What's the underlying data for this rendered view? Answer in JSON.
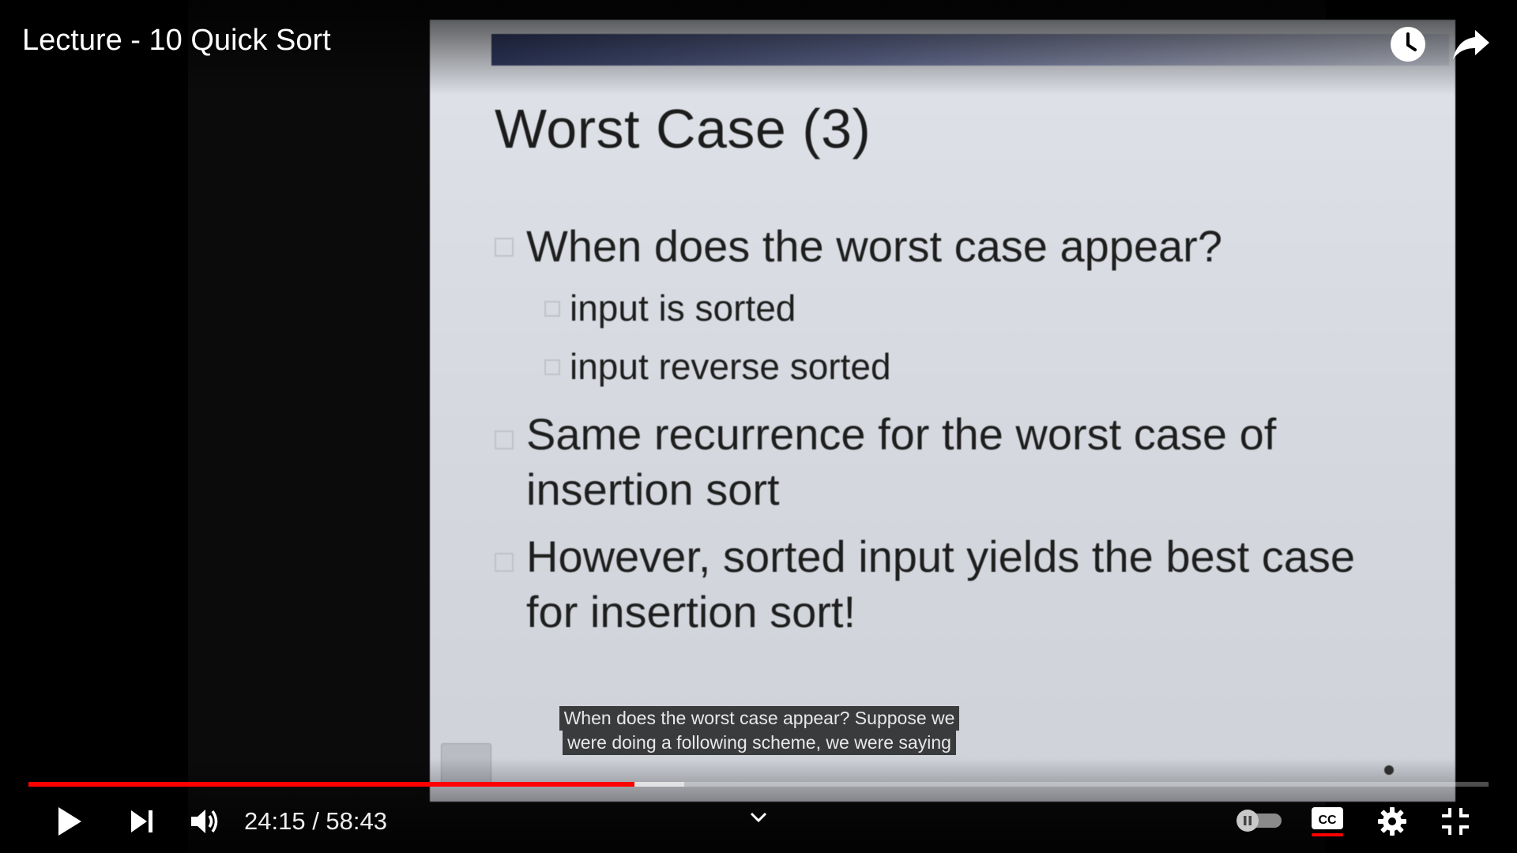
{
  "video": {
    "title": "Lecture - 10 Quick Sort"
  },
  "slide": {
    "title": "Worst Case (3)",
    "bullets": {
      "b1": "When does the worst case appear?",
      "s1": "input is sorted",
      "s2": "input reverse sorted",
      "b2": "Same recurrence for the worst case of insertion sort",
      "b3": "However, sorted input yields the best case for insertion sort!"
    }
  },
  "captions": {
    "line1": "When does the worst case appear? Suppose we",
    "line2": "were doing a following scheme, we were saying"
  },
  "player": {
    "current_time": "24:15",
    "separator": " / ",
    "duration": "58:43",
    "progress_played": 0.415,
    "progress_buffered": 0.449,
    "autoplay_on": false,
    "captions_on": true,
    "accent_color": "#ff0000"
  },
  "icons": {
    "watch_later": "clock-icon",
    "share": "share-arrow-icon",
    "play": "play-icon",
    "next": "next-icon",
    "volume": "volume-icon",
    "chevron": "chevron-down-icon",
    "autoplay": "autoplay-toggle-icon",
    "cc": "closed-captions-icon",
    "settings": "gear-icon",
    "fullscreen": "exit-fullscreen-icon"
  }
}
